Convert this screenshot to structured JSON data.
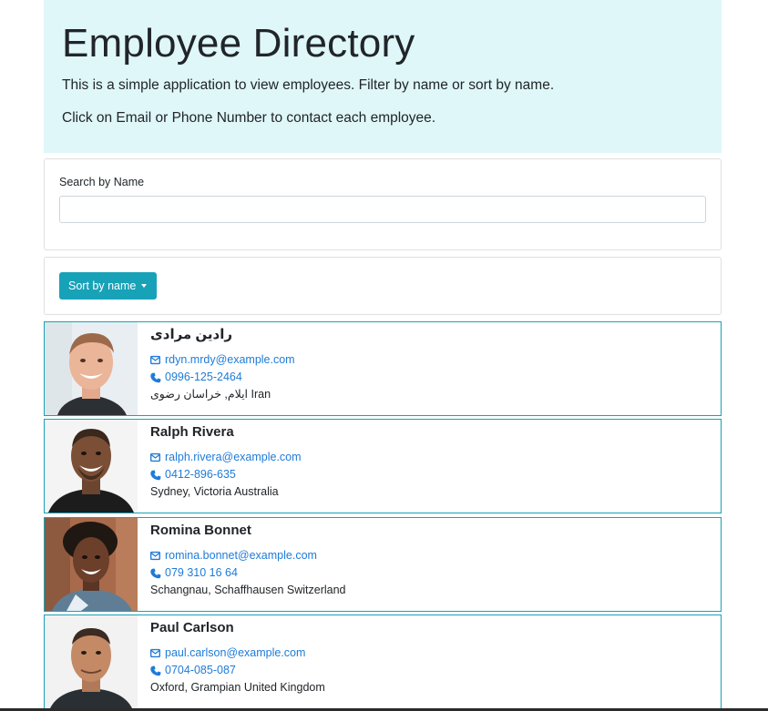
{
  "header": {
    "title": "Employee Directory",
    "lead": "This is a simple application to view employees. Filter by name or sort by name.",
    "lead2": "Click on Email or Phone Number to contact each employee."
  },
  "search": {
    "label": "Search by Name",
    "value": "",
    "placeholder": ""
  },
  "sort": {
    "label": "Sort by name"
  },
  "colors": {
    "jumbotron_bg": "#dff7f9",
    "accent": "#17a2b8",
    "link": "#1e7bd8"
  },
  "employees": [
    {
      "name": "رادین مرادی",
      "email": "rdyn.mrdy@example.com",
      "phone": "0996-125-2464",
      "location": "ایلام, خراسان رضوی Iran",
      "photo": "man-smiling-portrait"
    },
    {
      "name": "Ralph Rivera",
      "email": "ralph.rivera@example.com",
      "phone": "0412-896-635",
      "location": "Sydney, Victoria Australia",
      "photo": "man-smiling-portrait"
    },
    {
      "name": "Romina Bonnet",
      "email": "romina.bonnet@example.com",
      "phone": "079 310 16 64",
      "location": "Schangnau, Schaffhausen Switzerland",
      "photo": "woman-smiling-portrait"
    },
    {
      "name": "Paul Carlson",
      "email": "paul.carlson@example.com",
      "phone": "0704-085-087",
      "location": "Oxford, Grampian United Kingdom",
      "photo": "man-portrait"
    }
  ]
}
